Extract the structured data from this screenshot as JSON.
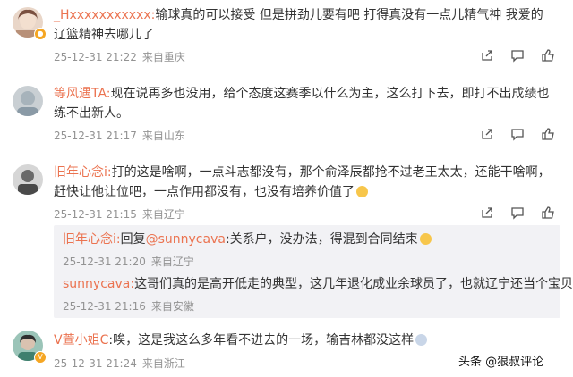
{
  "comments": [
    {
      "username": "_Hxxxxxxxxxxx:",
      "text": "输球真的可以接受 但是拼劲儿要有吧 打得真没有一点儿精气神 我爱的辽篮精神去哪儿了",
      "timestamp": "25-12-31 21:22",
      "location": "来自重庆",
      "avatar_color": "#b89078"
    },
    {
      "username": "等风遇TA:",
      "text": "现在说再多也没用，给个态度这赛季以什么为主，这么打下去，即打不出成绩也练不出新人。",
      "timestamp": "25-12-31 21:17",
      "location": "来自山东",
      "avatar_color": "#8a9aa6"
    },
    {
      "username": "旧年心念i:",
      "text": "打的这是啥啊，一点斗志都没有，那个俞泽辰都抢不过老王太太，还能干啥啊，赶快让他让位吧，一点作用都没有，也没有培养价值了",
      "timestamp": "25-12-31 21:15",
      "location": "来自辽宁",
      "avatar_color": "#4a4a4a",
      "replies": [
        {
          "username": "旧年心念i:",
          "prefix": "回复",
          "mention": "@sunnycava",
          "text": ":关系户，没办法，得混到合同结束",
          "timestamp": "25-12-31 21:20",
          "location": "来自辽宁"
        },
        {
          "username": "sunnycava:",
          "text": "这哥们真的是高开低走的典型，这几年退化成业余球员了，也就辽宁还当个宝贝",
          "timestamp": "25-12-31 21:16",
          "location": "来自安徽"
        }
      ]
    },
    {
      "username": "V萱小姐C",
      "text": ":唉，这是我这么多年看不进去的一场，输吉林都没这样",
      "timestamp": "25-12-31 21:24",
      "location": "来自浙江",
      "avatar_color": "#3f7f6e",
      "verified_badge": "V"
    }
  ],
  "watermark": "头条 @狠叔评论",
  "colors": {
    "username": "#eb7350",
    "meta": "#939393",
    "reply_bg": "#f2f2f5"
  }
}
